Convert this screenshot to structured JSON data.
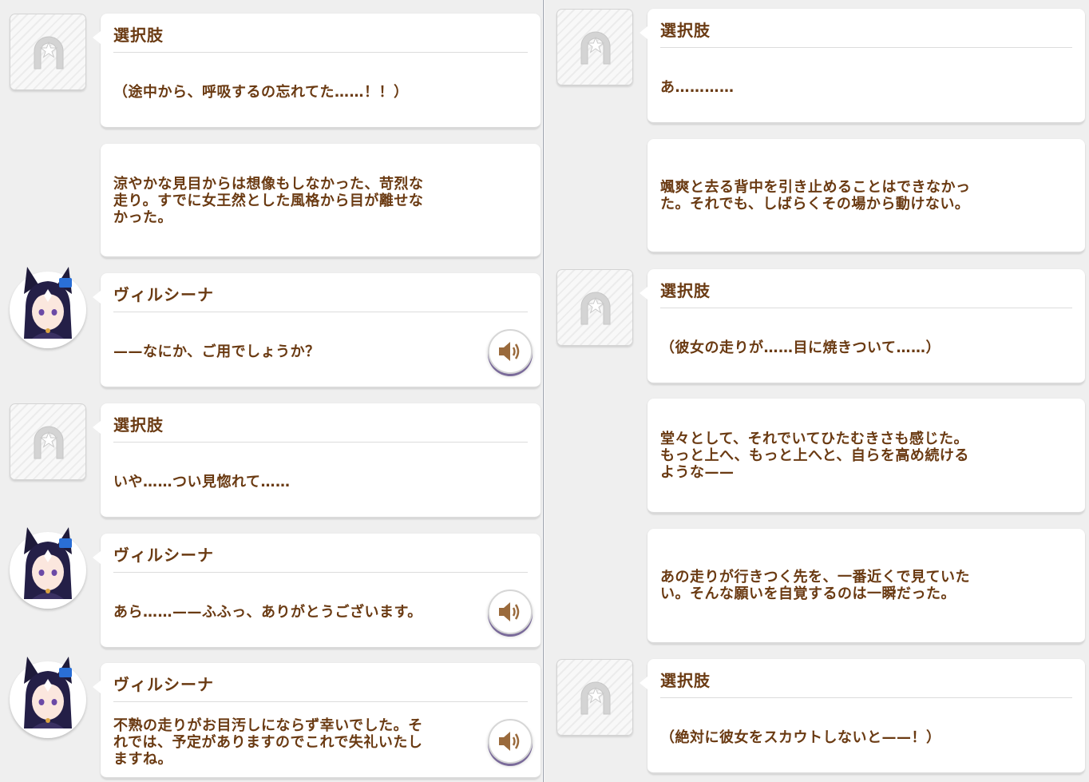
{
  "colors": {
    "text": "#6a3a12",
    "bubble": "#ffffff",
    "background": "#efefef"
  },
  "left_column": {
    "entries": [
      {
        "type": "choice",
        "speaker": "選択肢",
        "text": "（途中から、呼吸するの忘れてた……！！）",
        "icon": "horseshoe-star-icon"
      },
      {
        "type": "narration",
        "text": "涼やかな見目からは想像もしなかった、苛烈な\n走り。すでに女王然とした風格から目が離せな\nかった。"
      },
      {
        "type": "dialogue",
        "speaker": "ヴィルシーナ",
        "text": "——なにか、ご用でしょうか？",
        "icon": "speaker-icon"
      },
      {
        "type": "choice",
        "speaker": "選択肢",
        "text": "いや……つい見惚れて……",
        "icon": "horseshoe-star-icon"
      },
      {
        "type": "dialogue",
        "speaker": "ヴィルシーナ",
        "text": "あら……——ふふっ、ありがとうございます。",
        "icon": "speaker-icon"
      },
      {
        "type": "dialogue",
        "speaker": "ヴィルシーナ",
        "text": "不熟の走りがお目汚しにならず幸いでした。そ\nれでは、予定がありますのでこれで失礼いたし\nますね。",
        "icon": "speaker-icon"
      }
    ]
  },
  "right_column": {
    "entries": [
      {
        "type": "choice",
        "speaker": "選択肢",
        "text": "あ…………",
        "icon": "horseshoe-star-icon"
      },
      {
        "type": "narration",
        "text": "颯爽と去る背中を引き止めることはできなかっ\nた。それでも、しばらくその場から動けない。"
      },
      {
        "type": "choice",
        "speaker": "選択肢",
        "text": "（彼女の走りが……目に焼きついて……）",
        "icon": "horseshoe-star-icon"
      },
      {
        "type": "narration",
        "text": "堂々として、それでいてひたむきさも感じた。\nもっと上へ、もっと上へと、自らを高め続ける\nような——"
      },
      {
        "type": "narration",
        "text": "あの走りが行きつく先を、一番近くで見ていた\nい。そんな願いを自覚するのは一瞬だった。"
      },
      {
        "type": "choice",
        "speaker": "選択肢",
        "text": "（絶対に彼女をスカウトしないと——！）",
        "icon": "horseshoe-star-icon"
      }
    ]
  }
}
